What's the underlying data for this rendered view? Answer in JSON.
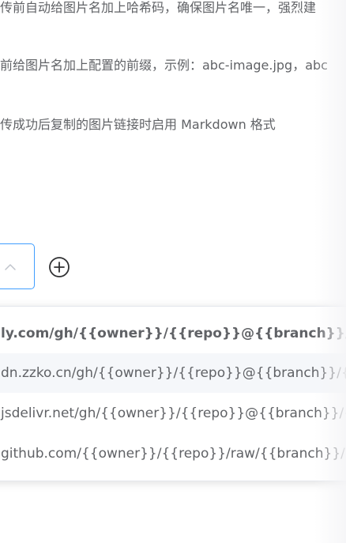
{
  "settings": {
    "hash_desc": "传前自动给图片名加上哈希码，确保图片名唯一，强烈建",
    "prefix_desc": "前给图片名加上配置的前缀，示例：abc-image.jpg，abc",
    "markdown_desc": "传成功后复制的图片链接时启用 Markdown 格式"
  },
  "cdn_select": {
    "arrow_icon": "chevron-up-icon",
    "add_icon": "plus-circle-icon",
    "accent_color": "#409eff"
  },
  "cdn_options": [
    "ly.com/gh/{{owner}}/{{repo}}@{{branch}}/{{path",
    "dn.zzko.cn/gh/{{owner}}/{{repo}}@{{branch}}/{{path",
    "jsdelivr.net/gh/{{owner}}/{{repo}}@{{branch}}/{{path",
    "github.com/{{owner}}/{{repo}}/raw/{{branch}}/{{path"
  ]
}
